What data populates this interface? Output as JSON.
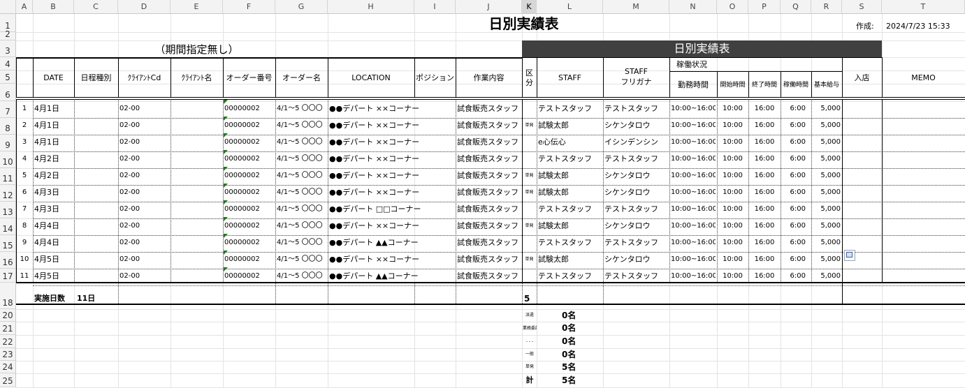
{
  "sheet": {
    "title": "日別実績表",
    "created_label": "作成:",
    "created_value": "2024/7/23 15:33",
    "period_label": "（期間指定無し）",
    "band_title": "日別実績表",
    "columns": [
      "A",
      "B",
      "C",
      "D",
      "E",
      "F",
      "G",
      "H",
      "I",
      "J",
      "K",
      "L",
      "M",
      "N",
      "O",
      "P",
      "Q",
      "R",
      "S",
      "T"
    ],
    "rows": [
      "1",
      "2",
      "3",
      "4",
      "5",
      "6",
      "7",
      "8",
      "9",
      "10",
      "11",
      "12",
      "13",
      "14",
      "15",
      "16",
      "17",
      "18",
      "20",
      "21",
      "22",
      "23",
      "24",
      "25"
    ],
    "headers": {
      "date": "DATE",
      "schedule_type": "日程種別",
      "client_cd": "ｸﾗｲｱﾝﾄCd",
      "client_name": "ｸﾗｲｱﾝﾄ名",
      "order_no": "オーダー番号",
      "order_name": "オーダー名",
      "location": "LOCATION",
      "position": "ポジション",
      "work": "作業内容",
      "kubun": "区分",
      "staff": "STAFF",
      "staff_kana_1": "STAFF",
      "staff_kana_2": "フリガナ",
      "work_status": "稼働状況",
      "work_time": "勤務時間",
      "start_time": "開始時間",
      "end_time": "終了時間",
      "hours": "稼働時間",
      "base_pay": "基本給与",
      "entry": "入店",
      "memo": "MEMO"
    },
    "records": [
      {
        "no": "1",
        "date": "4月1日",
        "client_cd": "02-00",
        "order_no": "00000002",
        "order_name": "4/1～5 〇〇〇",
        "location": "●●デパート ××コーナー",
        "work": "試食販売スタッフ",
        "kubun": "",
        "staff": "テストスタッフ",
        "kana": "テストスタッフ",
        "work_time": "10:00~16:00",
        "start": "10:00",
        "end": "16:00",
        "hours": "6:00",
        "pay": "5,000"
      },
      {
        "no": "2",
        "date": "4月1日",
        "client_cd": "02-00",
        "order_no": "00000002",
        "order_name": "4/1～5 〇〇〇",
        "location": "●●デパート ××コーナー",
        "work": "試食販売スタッフ",
        "kubun": "単発",
        "staff": "試験太郎",
        "kana": "シケンタロウ",
        "work_time": "10:00~16:00",
        "start": "10:00",
        "end": "16:00",
        "hours": "6:00",
        "pay": "5,000"
      },
      {
        "no": "3",
        "date": "4月1日",
        "client_cd": "02-00",
        "order_no": "00000002",
        "order_name": "4/1～5 〇〇〇",
        "location": "●●デパート ××コーナー",
        "work": "試食販売スタッフ",
        "kubun": "",
        "staff": "e心伝心",
        "kana": "イシンデンシン",
        "work_time": "10:00~16:00",
        "start": "10:00",
        "end": "16:00",
        "hours": "6:00",
        "pay": "5,000"
      },
      {
        "no": "4",
        "date": "4月2日",
        "client_cd": "02-00",
        "order_no": "00000002",
        "order_name": "4/1～5 〇〇〇",
        "location": "●●デパート ××コーナー",
        "work": "試食販売スタッフ",
        "kubun": "",
        "staff": "テストスタッフ",
        "kana": "テストスタッフ",
        "work_time": "10:00~16:00",
        "start": "10:00",
        "end": "16:00",
        "hours": "6:00",
        "pay": "5,000"
      },
      {
        "no": "5",
        "date": "4月2日",
        "client_cd": "02-00",
        "order_no": "00000002",
        "order_name": "4/1～5 〇〇〇",
        "location": "●●デパート ××コーナー",
        "work": "試食販売スタッフ",
        "kubun": "単発",
        "staff": "試験太郎",
        "kana": "シケンタロウ",
        "work_time": "10:00~16:00",
        "start": "10:00",
        "end": "16:00",
        "hours": "6:00",
        "pay": "5,000"
      },
      {
        "no": "6",
        "date": "4月3日",
        "client_cd": "02-00",
        "order_no": "00000002",
        "order_name": "4/1～5 〇〇〇",
        "location": "●●デパート ××コーナー",
        "work": "試食販売スタッフ",
        "kubun": "単発",
        "staff": "試験太郎",
        "kana": "シケンタロウ",
        "work_time": "10:00~16:00",
        "start": "10:00",
        "end": "16:00",
        "hours": "6:00",
        "pay": "5,000"
      },
      {
        "no": "7",
        "date": "4月3日",
        "client_cd": "02-00",
        "order_no": "00000002",
        "order_name": "4/1～5 〇〇〇",
        "location": "●●デパート □□コーナー",
        "work": "試食販売スタッフ",
        "kubun": "",
        "staff": "テストスタッフ",
        "kana": "テストスタッフ",
        "work_time": "10:00~16:00",
        "start": "10:00",
        "end": "16:00",
        "hours": "6:00",
        "pay": "5,000"
      },
      {
        "no": "8",
        "date": "4月4日",
        "client_cd": "02-00",
        "order_no": "00000002",
        "order_name": "4/1～5 〇〇〇",
        "location": "●●デパート ××コーナー",
        "work": "試食販売スタッフ",
        "kubun": "単発",
        "staff": "試験太郎",
        "kana": "シケンタロウ",
        "work_time": "10:00~16:00",
        "start": "10:00",
        "end": "16:00",
        "hours": "6:00",
        "pay": "5,000"
      },
      {
        "no": "9",
        "date": "4月4日",
        "client_cd": "02-00",
        "order_no": "00000002",
        "order_name": "4/1～5 〇〇〇",
        "location": "●●デパート ▲▲コーナー",
        "work": "試食販売スタッフ",
        "kubun": "",
        "staff": "テストスタッフ",
        "kana": "テストスタッフ",
        "work_time": "10:00~16:00",
        "start": "10:00",
        "end": "16:00",
        "hours": "6:00",
        "pay": "5,000"
      },
      {
        "no": "10",
        "date": "4月5日",
        "client_cd": "02-00",
        "order_no": "00000002",
        "order_name": "4/1～5 〇〇〇",
        "location": "●●デパート ××コーナー",
        "work": "試食販売スタッフ",
        "kubun": "単発",
        "staff": "試験太郎",
        "kana": "シケンタロウ",
        "work_time": "10:00~16:00",
        "start": "10:00",
        "end": "16:00",
        "hours": "6:00",
        "pay": "5,000"
      },
      {
        "no": "11",
        "date": "4月5日",
        "client_cd": "02-00",
        "order_no": "00000002",
        "order_name": "4/1～5 〇〇〇",
        "location": "●●デパート ▲▲コーナー",
        "work": "試食販売スタッフ",
        "kubun": "",
        "staff": "テストスタッフ",
        "kana": "テストスタッフ",
        "work_time": "10:00~16:00",
        "start": "10:00",
        "end": "16:00",
        "hours": "6:00",
        "pay": "5,000"
      }
    ],
    "footer": {
      "days_label": "実施日数",
      "days_value": "11日",
      "kubun_total": "5"
    },
    "summary": [
      {
        "label": "派遣",
        "value": "0名",
        "tiny": true
      },
      {
        "label": "業務委託",
        "value": "0名",
        "tiny": true
      },
      {
        "label": "- - -",
        "value": "0名",
        "tiny": true
      },
      {
        "label": "一般",
        "value": "0名",
        "tiny": true
      },
      {
        "label": "単発",
        "value": "5名",
        "tiny": true
      },
      {
        "label": "計",
        "value": "5名",
        "tiny": false
      }
    ],
    "colors": {
      "band_bg": "#404040",
      "band_fg": "#ffffff",
      "error_triangle": "#1a7a1a"
    },
    "icons": [
      "paste-options-icon"
    ]
  }
}
